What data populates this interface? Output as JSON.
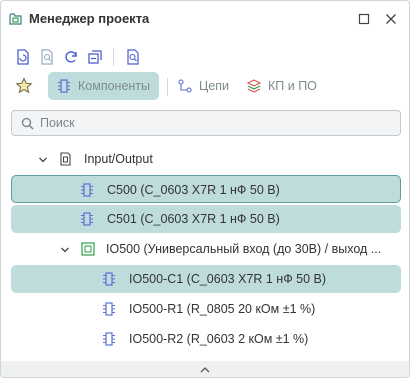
{
  "window": {
    "title": "Менеджер проекта",
    "icon": "project-icon",
    "buttons": [
      {
        "name": "restore-icon"
      },
      {
        "name": "close-icon"
      }
    ]
  },
  "toolbar": {
    "buttons": [
      {
        "icon": "document-refresh-icon"
      },
      {
        "icon": "document-search-icon"
      },
      {
        "icon": "refresh-icon"
      },
      {
        "icon": "collapse-icon"
      },
      {
        "icon": "filter-search-icon"
      }
    ]
  },
  "tabs": {
    "favorites_icon": "star-icon",
    "items": [
      {
        "label": "Компоненты",
        "icon": "component-icon",
        "active": true
      },
      {
        "label": "Цепи",
        "icon": "net-icon",
        "active": false
      },
      {
        "label": "КП и ПО",
        "icon": "layers-icon",
        "active": false
      }
    ]
  },
  "search": {
    "placeholder": "Поиск",
    "value": ""
  },
  "tree": {
    "group": {
      "label": "Input/Output",
      "expanded": true
    },
    "items": [
      {
        "label": "C500 (C_0603 X7R 1 нФ 50 В)",
        "selected": true
      },
      {
        "label": "C501 (C_0603 X7R 1 нФ 50 В)",
        "selected": true
      },
      {
        "label": "IO500 (Универсальный вход (до 30В) / выход ...",
        "expanded": true
      },
      {
        "label": "IO500-C1 (C_0603 X7R 1 нФ 50 В)",
        "selected": true
      },
      {
        "label": "IO500-R1 (R_0805 20 кОм ±1 %)",
        "selected": false
      },
      {
        "label": "IO500-R2 (R_0603 2 кОм ±1 %)",
        "selected": false
      }
    ]
  },
  "colors": {
    "selection": "#bfdcdd",
    "focus_border": "#5f9ea0",
    "component_icon": "#5b6fd6",
    "accent": "#3a7f83"
  }
}
